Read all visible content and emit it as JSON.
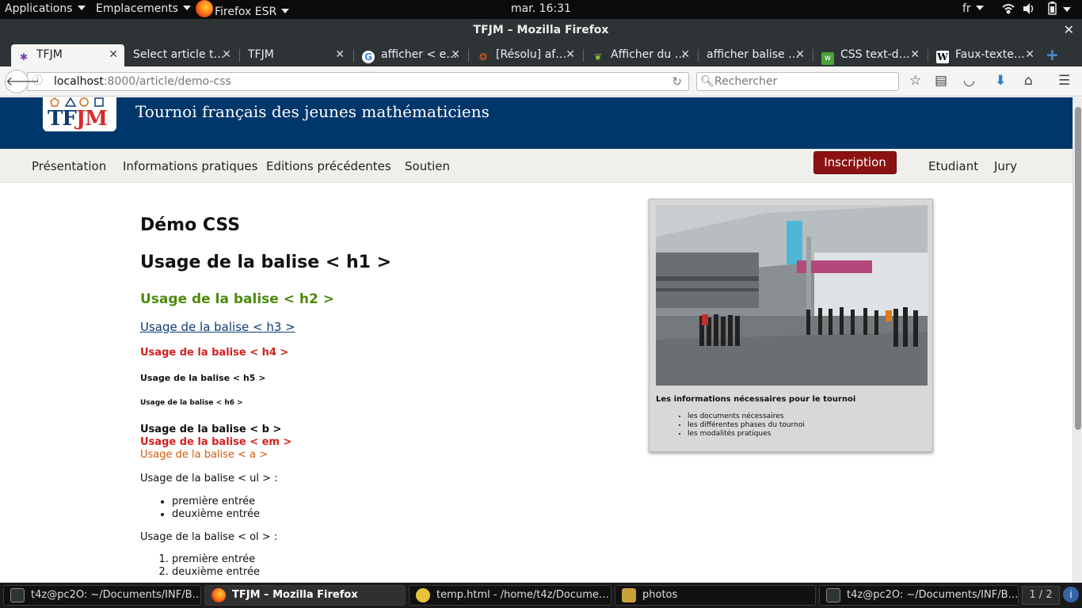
{
  "topbar": {
    "applications": "Applications",
    "places": "Emplacements",
    "active_app": "Firefox ESR",
    "clock": "mar. 16:31",
    "keyboard": "fr"
  },
  "window": {
    "title": "TFJM – Mozilla Firefox"
  },
  "tabs": [
    {
      "label": "TFJM"
    },
    {
      "label": "Select article t…"
    },
    {
      "label": "TFJM"
    },
    {
      "label": "afficher < e…"
    },
    {
      "label": "[Résolu] af…"
    },
    {
      "label": "Afficher du …"
    },
    {
      "label": "afficher balise …"
    },
    {
      "label": "CSS text-d…"
    },
    {
      "label": "Faux-texte…"
    }
  ],
  "navbar": {
    "url_host": "localhost",
    "url_rest": ":8000/article/demo-css",
    "search_placeholder": "Rechercher"
  },
  "site": {
    "title": "Tournoi français des jeunes mathématiciens",
    "logo_text_a": "TF",
    "logo_text_b": "JM",
    "menu": [
      "Présentation",
      "Informations pratiques",
      "Editions précédentes",
      "Soutien"
    ],
    "inscription": "Inscription",
    "etudiant": "Etudiant",
    "jury": "Jury"
  },
  "content": {
    "page_title": "Démo CSS",
    "h1": "Usage de la balise < h1 >",
    "h2": "Usage de la balise < h2 >",
    "h3": "Usage de la balise < h3 >",
    "h4": "Usage de la balise < h4 >",
    "h5": "Usage de la balise < h5 >",
    "h6": "Usage de la balise < h6 >",
    "b": "Usage de la balise < b >",
    "em": "Usage de la balise < em >",
    "a": "Usage de la balise < a >",
    "ul_intro": "Usage de la balise < ul > :",
    "ul_items": [
      "première entrée",
      "deuxième entrée"
    ],
    "ol_intro": "Usage de la balise < ol > :",
    "ol_items": [
      "première entrée",
      "deuxième entrée"
    ]
  },
  "infobox": {
    "caption": "Les informations nécessaires pour le tournoi",
    "items": [
      "les documents nécessaires",
      "les différentes phases du tournoi",
      "les modalités pratiques"
    ]
  },
  "taskbar": {
    "tasks": [
      "t4z@pc2O: ~/Documents/INF/B…",
      "TFJM – Mozilla Firefox",
      "temp.html - /home/t4z/Docume…",
      "photos",
      "t4z@pc2O: ~/Documents/INF/B…"
    ],
    "pager": "1 / 2"
  },
  "colors": {
    "header_blue": "#00376b",
    "menu_bg": "#f0efec",
    "inscription_red": "#8c1212",
    "h2_green": "#4e8a0e",
    "h4_red": "#d42020",
    "link_orange": "#d45a0a"
  }
}
